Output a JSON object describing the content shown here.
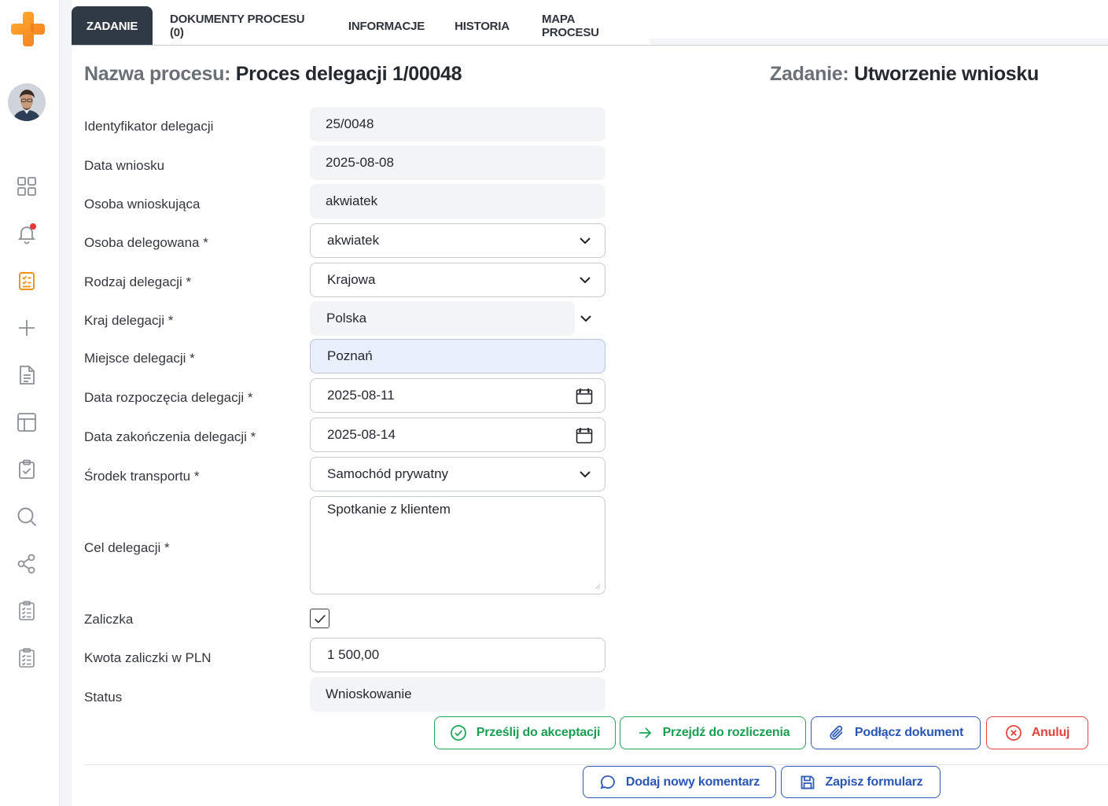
{
  "sidebar": {
    "logo_icon": "plus-logo-icon",
    "avatar_icon": "user-avatar",
    "items": [
      {
        "icon": "dashboard-icon"
      },
      {
        "icon": "bell-icon",
        "has_badge": true
      },
      {
        "icon": "task-list-icon",
        "active": true
      },
      {
        "icon": "plus-icon"
      },
      {
        "icon": "document-icon"
      },
      {
        "icon": "layout-icon"
      },
      {
        "icon": "clipboard-check-icon"
      },
      {
        "icon": "search-icon"
      },
      {
        "icon": "share-icon"
      },
      {
        "icon": "checklist-icon"
      },
      {
        "icon": "checklist-icon-2"
      }
    ]
  },
  "tabs": [
    {
      "label": "ZADANIE",
      "active": true
    },
    {
      "label": "DOKUMENTY PROCESU (0)"
    },
    {
      "label": "INFORMACJE"
    },
    {
      "label": "HISTORIA"
    },
    {
      "label": "MAPA PROCESU"
    }
  ],
  "header": {
    "process_label": "Nazwa procesu:",
    "process_value": "Proces delegacji 1/00048",
    "task_label": "Zadanie:",
    "task_value": "Utworzenie wniosku"
  },
  "form": {
    "delegation_id": {
      "label": "Identyfikator delegacji",
      "value": "25/0048"
    },
    "request_date": {
      "label": "Data wniosku",
      "value": "2025-08-08"
    },
    "requester": {
      "label": "Osoba wnioskująca",
      "value": "akwiatek"
    },
    "delegate": {
      "label": "Osoba delegowana *",
      "value": "akwiatek"
    },
    "delegation_type": {
      "label": "Rodzaj delegacji *",
      "value": "Krajowa"
    },
    "country": {
      "label": "Kraj delegacji *",
      "value": "Polska"
    },
    "place": {
      "label": "Miejsce delegacji *",
      "value": "Poznań"
    },
    "start_date": {
      "label": "Data rozpoczęcia delegacji *",
      "value": "2025-08-11"
    },
    "end_date": {
      "label": "Data zakończenia delegacji *",
      "value": "2025-08-14"
    },
    "transport": {
      "label": "Środek transportu *",
      "value": "Samochód prywatny"
    },
    "purpose": {
      "label": "Cel delegacji *",
      "value": "Spotkanie z klientem"
    },
    "advance": {
      "label": "Zaliczka",
      "checked": true
    },
    "advance_amount": {
      "label": "Kwota zaliczki w PLN",
      "value": "1 500,00"
    },
    "status": {
      "label": "Status",
      "value": "Wnioskowanie"
    }
  },
  "actions": {
    "send_for_approval": "Prześlij do akceptacji",
    "go_to_settlement": "Przejdź do rozliczenia",
    "attach_document": "Podłącz dokument",
    "cancel": "Anuluj",
    "add_comment": "Dodaj nowy komentarz",
    "save_form": "Zapisz formularz"
  },
  "colors": {
    "brand_orange": "#f7941d",
    "active_tab_bg": "#2f3a44",
    "green": "#1fa65a",
    "blue": "#2f5bb7",
    "red": "#e2453c",
    "focus_bg": "#e9effb"
  }
}
